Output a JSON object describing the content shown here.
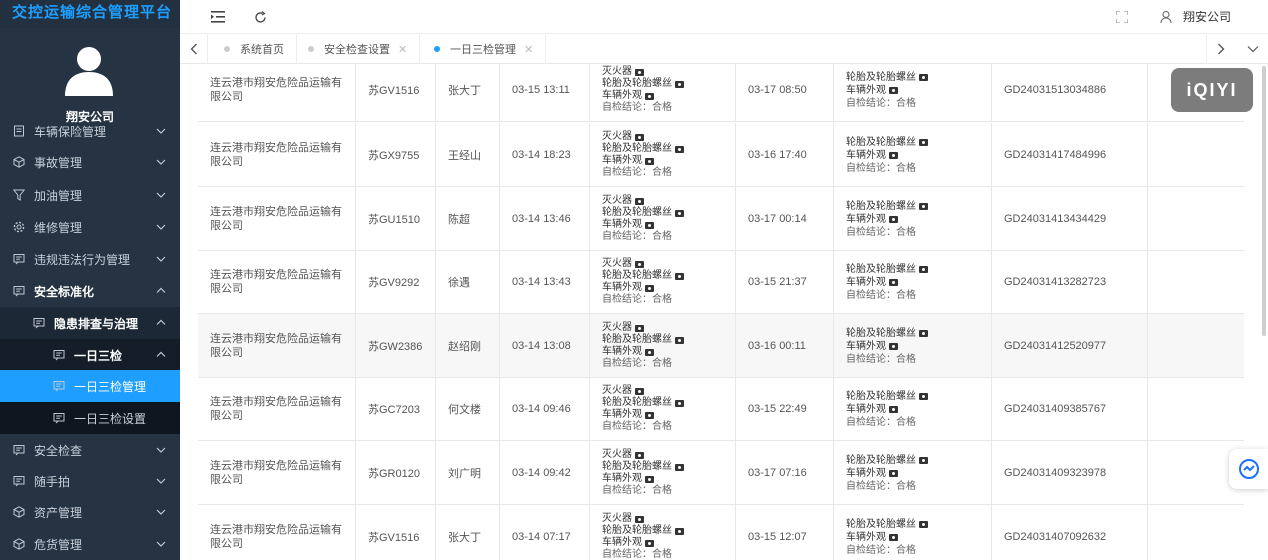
{
  "sidebar": {
    "brand": "交控运输综合管理平台",
    "company": "翔安公司",
    "items": [
      {
        "label": "车辆保险管理",
        "icon": "document-icon"
      },
      {
        "label": "事故管理",
        "icon": "cube-icon"
      },
      {
        "label": "加油管理",
        "icon": "filter-icon"
      },
      {
        "label": "维修管理",
        "icon": "gear-icon"
      },
      {
        "label": "违规违法行为管理",
        "icon": "message-icon"
      },
      {
        "label": "安全标准化",
        "icon": "message-icon"
      },
      {
        "label": "隐患排查与治理",
        "icon": "message-icon"
      },
      {
        "label": "一日三检",
        "icon": "message-icon"
      },
      {
        "label": "一日三检管理",
        "icon": "message-icon"
      },
      {
        "label": "一日三检设置",
        "icon": "message-icon"
      },
      {
        "label": "安全检查",
        "icon": "message-icon"
      },
      {
        "label": "随手拍",
        "icon": "message-icon"
      },
      {
        "label": "资产管理",
        "icon": "cube-icon"
      },
      {
        "label": "危货管理",
        "icon": "cube-icon"
      }
    ]
  },
  "topbar": {
    "user": "翔安公司"
  },
  "tabs": [
    {
      "label": "系统首页",
      "closable": false
    },
    {
      "label": "安全检查设置",
      "closable": true
    },
    {
      "label": "一日三检管理",
      "closable": true
    }
  ],
  "table": {
    "rows": [
      {
        "company": "连云港市翔安危险品运输有限公司",
        "plate": "苏GV1516",
        "driver": "张大丁",
        "time1": "03-15 13:11",
        "time2": "03-17 08:50",
        "code": "GD24031513034886"
      },
      {
        "company": "连云港市翔安危险品运输有限公司",
        "plate": "苏GX9755",
        "driver": "王经山",
        "time1": "03-14 18:23",
        "time2": "03-16 17:40",
        "code": "GD24031417484996"
      },
      {
        "company": "连云港市翔安危险品运输有限公司",
        "plate": "苏GU1510",
        "driver": "陈超",
        "time1": "03-14 13:46",
        "time2": "03-17 00:14",
        "code": "GD24031413434429"
      },
      {
        "company": "连云港市翔安危险品运输有限公司",
        "plate": "苏GV9292",
        "driver": "徐遇",
        "time1": "03-14 13:43",
        "time2": "03-15 21:37",
        "code": "GD24031413282723"
      },
      {
        "company": "连云港市翔安危险品运输有限公司",
        "plate": "苏GW2386",
        "driver": "赵绍刚",
        "time1": "03-14 13:08",
        "time2": "03-16 00:11",
        "code": "GD24031412520977"
      },
      {
        "company": "连云港市翔安危险品运输有限公司",
        "plate": "苏GC7203",
        "driver": "何文楼",
        "time1": "03-14 09:46",
        "time2": "03-15 22:49",
        "code": "GD24031409385767"
      },
      {
        "company": "连云港市翔安危险品运输有限公司",
        "plate": "苏GR0120",
        "driver": "刘广明",
        "time1": "03-14 09:42",
        "time2": "03-17 07:16",
        "code": "GD24031409323978"
      },
      {
        "company": "连云港市翔安危险品运输有限公司",
        "plate": "苏GV1516",
        "driver": "张大丁",
        "time1": "03-14 07:17",
        "time2": "03-15 12:07",
        "code": "GD24031407092632"
      }
    ],
    "check1_items": [
      "灭火器",
      "轮胎及轮胎螺丝",
      "车辆外观"
    ],
    "check2_items": [
      "轮胎及轮胎螺丝",
      "车辆外观"
    ],
    "conclusion": "自检结论：合格"
  },
  "overlay": {
    "watermark": "iQIYI"
  }
}
